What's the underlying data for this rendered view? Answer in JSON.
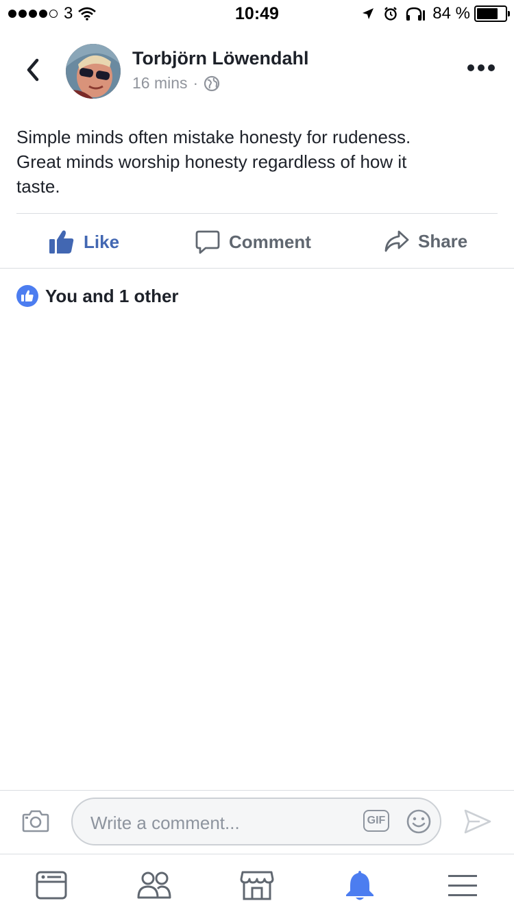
{
  "status_bar": {
    "carrier": "3",
    "time": "10:49",
    "battery": "84 %",
    "battery_level": 0.84
  },
  "post": {
    "author": "Torbjörn Löwendahl",
    "time_ago": "16 mins",
    "separator": "·",
    "privacy_icon": "globe-icon",
    "text_lines": [
      "Simple minds often mistake honesty for rudeness.",
      "Great minds worship honesty regardless of how it",
      "taste."
    ]
  },
  "actions": {
    "like_label": "Like",
    "comment_label": "Comment",
    "share_label": "Share"
  },
  "reactions": {
    "summary": "You and 1 other"
  },
  "composer": {
    "placeholder": "Write a comment...",
    "value": "",
    "gif_label": "GIF"
  },
  "tabbar": {
    "items": [
      "news-feed-icon",
      "friends-icon",
      "marketplace-icon",
      "notifications-icon",
      "menu-icon"
    ],
    "active": "notifications-icon"
  },
  "colors": {
    "brand_blue": "#4267b2",
    "active_tab": "#4c7df0",
    "muted": "#90949c"
  }
}
